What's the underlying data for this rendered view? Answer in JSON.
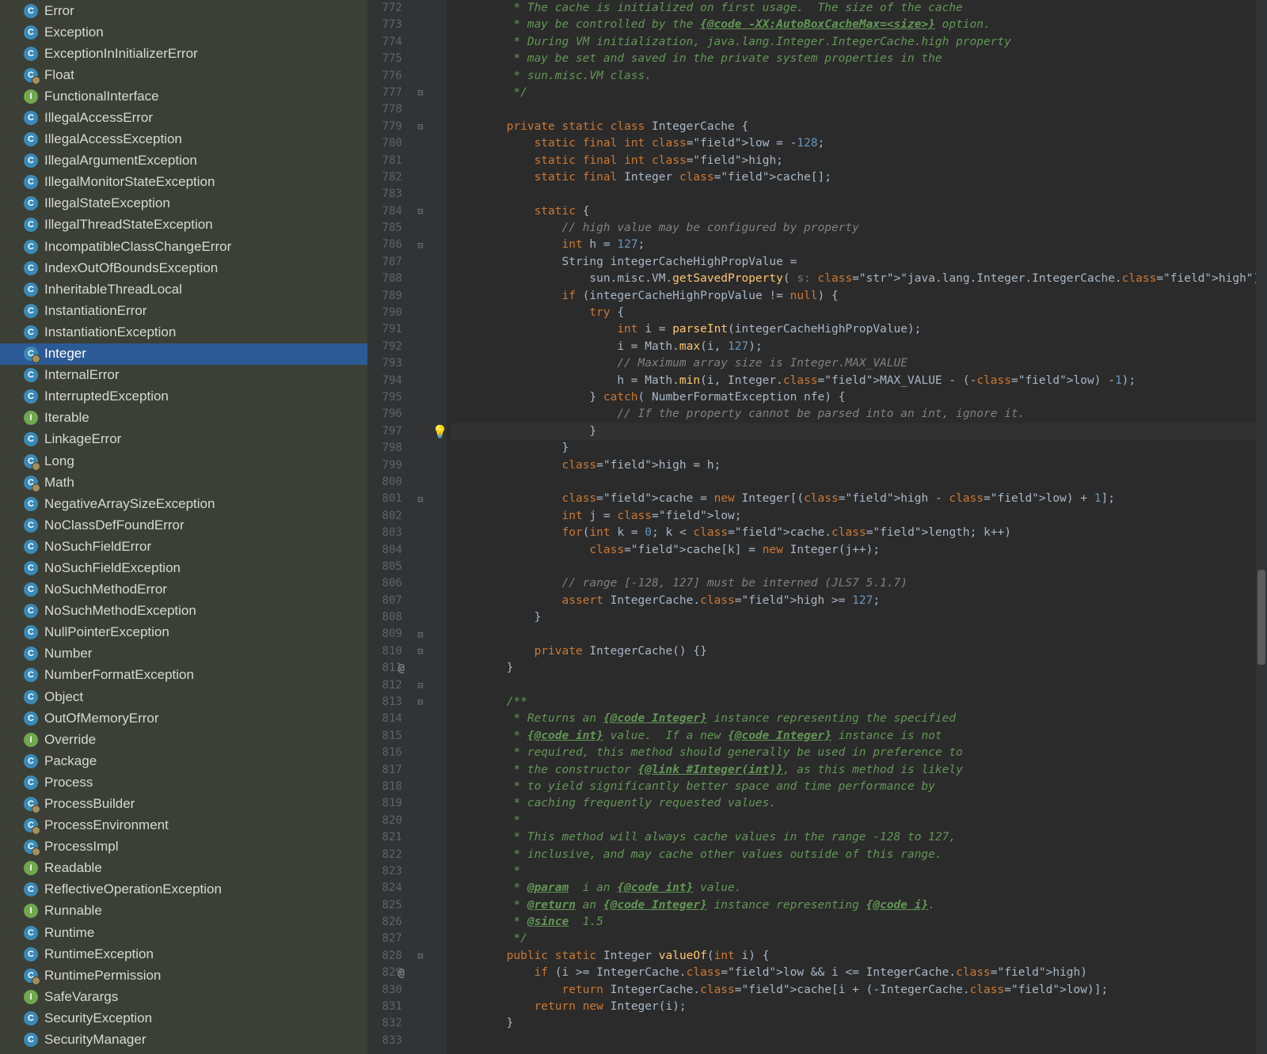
{
  "sidebar": {
    "items": [
      {
        "label": "Error",
        "type": "class"
      },
      {
        "label": "Exception",
        "type": "class"
      },
      {
        "label": "ExceptionInInitializerError",
        "type": "class"
      },
      {
        "label": "Float",
        "type": "class-final"
      },
      {
        "label": "FunctionalInterface",
        "type": "interface"
      },
      {
        "label": "IllegalAccessError",
        "type": "class"
      },
      {
        "label": "IllegalAccessException",
        "type": "class"
      },
      {
        "label": "IllegalArgumentException",
        "type": "class"
      },
      {
        "label": "IllegalMonitorStateException",
        "type": "class"
      },
      {
        "label": "IllegalStateException",
        "type": "class"
      },
      {
        "label": "IllegalThreadStateException",
        "type": "class"
      },
      {
        "label": "IncompatibleClassChangeError",
        "type": "class"
      },
      {
        "label": "IndexOutOfBoundsException",
        "type": "class"
      },
      {
        "label": "InheritableThreadLocal",
        "type": "class"
      },
      {
        "label": "InstantiationError",
        "type": "class"
      },
      {
        "label": "InstantiationException",
        "type": "class"
      },
      {
        "label": "Integer",
        "type": "class-final",
        "selected": true
      },
      {
        "label": "InternalError",
        "type": "class"
      },
      {
        "label": "InterruptedException",
        "type": "class"
      },
      {
        "label": "Iterable",
        "type": "interface"
      },
      {
        "label": "LinkageError",
        "type": "class"
      },
      {
        "label": "Long",
        "type": "class-final"
      },
      {
        "label": "Math",
        "type": "class-final"
      },
      {
        "label": "NegativeArraySizeException",
        "type": "class"
      },
      {
        "label": "NoClassDefFoundError",
        "type": "class"
      },
      {
        "label": "NoSuchFieldError",
        "type": "class"
      },
      {
        "label": "NoSuchFieldException",
        "type": "class"
      },
      {
        "label": "NoSuchMethodError",
        "type": "class"
      },
      {
        "label": "NoSuchMethodException",
        "type": "class"
      },
      {
        "label": "NullPointerException",
        "type": "class"
      },
      {
        "label": "Number",
        "type": "class"
      },
      {
        "label": "NumberFormatException",
        "type": "class"
      },
      {
        "label": "Object",
        "type": "class"
      },
      {
        "label": "OutOfMemoryError",
        "type": "class"
      },
      {
        "label": "Override",
        "type": "interface"
      },
      {
        "label": "Package",
        "type": "class"
      },
      {
        "label": "Process",
        "type": "class"
      },
      {
        "label": "ProcessBuilder",
        "type": "class-final"
      },
      {
        "label": "ProcessEnvironment",
        "type": "class-final"
      },
      {
        "label": "ProcessImpl",
        "type": "class-final"
      },
      {
        "label": "Readable",
        "type": "interface"
      },
      {
        "label": "ReflectiveOperationException",
        "type": "class"
      },
      {
        "label": "Runnable",
        "type": "interface"
      },
      {
        "label": "Runtime",
        "type": "class"
      },
      {
        "label": "RuntimeException",
        "type": "class"
      },
      {
        "label": "RuntimePermission",
        "type": "class-final"
      },
      {
        "label": "SafeVarargs",
        "type": "interface"
      },
      {
        "label": "SecurityException",
        "type": "class"
      },
      {
        "label": "SecurityManager",
        "type": "class"
      }
    ]
  },
  "editor": {
    "first_line": 772,
    "last_line": 833,
    "highlighted_line": 797,
    "lines": [
      "         * The cache is initialized on first usage.  The size of the cache",
      "         * may be controlled by the {@code -XX:AutoBoxCacheMax=<size>} option.",
      "         * During VM initialization, java.lang.Integer.IntegerCache.high property",
      "         * may be set and saved in the private system properties in the",
      "         * sun.misc.VM class.",
      "         */",
      "",
      "        private static class IntegerCache {",
      "            static final int low = -128;",
      "            static final int high;",
      "            static final Integer cache[];",
      "",
      "            static {",
      "                // high value may be configured by property",
      "                int h = 127;",
      "                String integerCacheHighPropValue =",
      "                    sun.misc.VM.getSavedProperty( s: \"java.lang.Integer.IntegerCache.high\");",
      "                if (integerCacheHighPropValue != null) {",
      "                    try {",
      "                        int i = parseInt(integerCacheHighPropValue);",
      "                        i = Math.max(i, 127);",
      "                        // Maximum array size is Integer.MAX_VALUE",
      "                        h = Math.min(i, Integer.MAX_VALUE - (-low) -1);",
      "                    } catch( NumberFormatException nfe) {",
      "                        // If the property cannot be parsed into an int, ignore it.",
      "                    }",
      "                }",
      "                high = h;",
      "",
      "                cache = new Integer[(high - low) + 1];",
      "                int j = low;",
      "                for(int k = 0; k < cache.length; k++)",
      "                    cache[k] = new Integer(j++);",
      "",
      "                // range [-128, 127] must be interned (JLS7 5.1.7)",
      "                assert IntegerCache.high >= 127;",
      "            }",
      "",
      "            private IntegerCache() {}",
      "        }",
      "",
      "        /**",
      "         * Returns an {@code Integer} instance representing the specified",
      "         * {@code int} value.  If a new {@code Integer} instance is not",
      "         * required, this method should generally be used in preference to",
      "         * the constructor {@link #Integer(int)}, as this method is likely",
      "         * to yield significantly better space and time performance by",
      "         * caching frequently requested values.",
      "         *",
      "         * This method will always cache values in the range -128 to 127,",
      "         * inclusive, and may cache other values outside of this range.",
      "         *",
      "         * @param  i an {@code int} value.",
      "         * @return an {@code Integer} instance representing {@code i}.",
      "         * @since  1.5",
      "         */",
      "        public static Integer valueOf(int i) {",
      "            if (i >= IntegerCache.low && i <= IntegerCache.high)",
      "                return IntegerCache.cache[i + (-IntegerCache.low)];",
      "            return new Integer(i);",
      "        }"
    ]
  },
  "gutter_marks": {
    "folds": [
      777,
      779,
      784,
      786,
      801,
      809,
      810,
      812,
      813,
      828
    ],
    "overrides": [
      811,
      829
    ],
    "bulb": 797
  }
}
